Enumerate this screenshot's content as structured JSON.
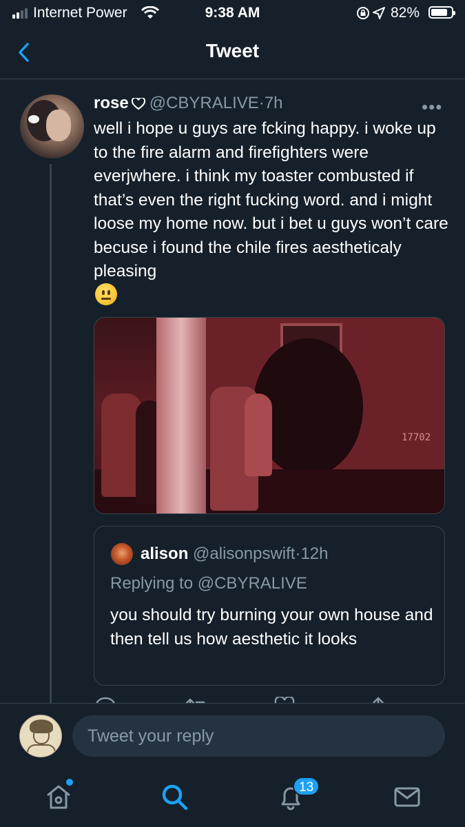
{
  "status_bar": {
    "carrier": "Internet Power",
    "time": "9:38 AM",
    "battery_percent": "82%",
    "battery_level": 0.82
  },
  "header": {
    "title": "Tweet",
    "back_icon": "chevron-left-icon"
  },
  "tweet": {
    "name": "rose",
    "handle": "@CBYRALIVE",
    "separator": "·",
    "time": "7h",
    "text": "well i hope u guys are fcking happy. i woke up to the fire alarm and firefighters were everjwhere. i think my toaster combusted if that’s even the right fucking word. and i might loose my home now. but i bet u guys won’t care becuse i found the chile fires aestheticaly pleasing",
    "emoji": "neutral-face-emoji",
    "media_number": "17702"
  },
  "quoted_tweet": {
    "name": "alison",
    "handle": "@alisonpswift",
    "separator": "·",
    "time": "12h",
    "replying_to": "Replying to @CBYRALIVE",
    "text": "you should try burning your own house and then tell us how aesthetic it looks"
  },
  "reply": {
    "placeholder": "Tweet your reply"
  },
  "tab_bar": {
    "tabs": [
      {
        "icon": "home-icon"
      },
      {
        "icon": "search-icon"
      },
      {
        "icon": "bell-icon"
      },
      {
        "icon": "mail-icon"
      }
    ],
    "notifications_count": "13"
  },
  "colors": {
    "background": "#15202b",
    "accent": "#1da1f2",
    "secondary_text": "#8899a6",
    "border": "#38444d"
  }
}
